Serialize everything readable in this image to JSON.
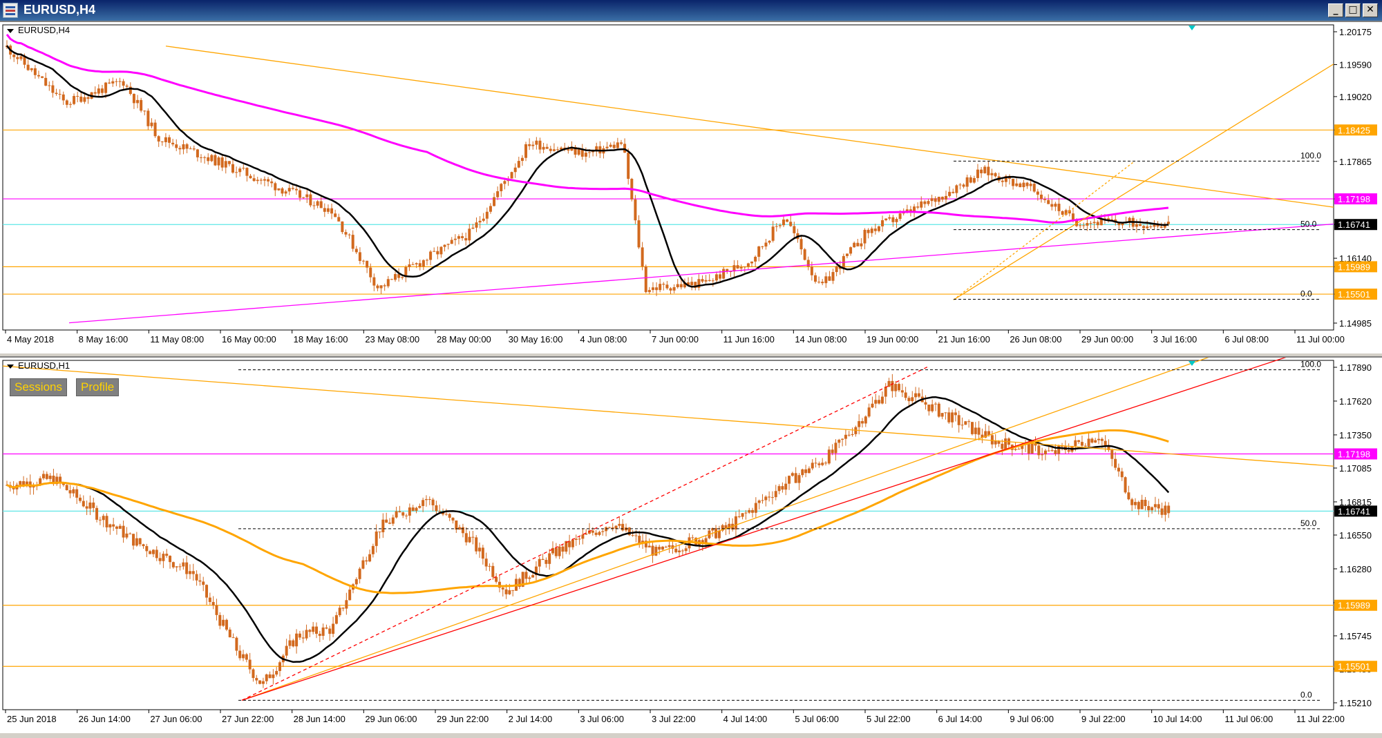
{
  "window": {
    "title": "EURUSD,H4",
    "buttons": [
      "_",
      "□",
      "✕"
    ]
  },
  "colors": {
    "candle": "#d2691e",
    "ma_fast": "#000000",
    "ma_slow_top": "#ff00ff",
    "ma_slow_bottom": "#ffa500",
    "level": "#ffa500",
    "level_magenta": "#ff00ff",
    "level_cyan": "#5ee6e6",
    "trend_red": "#ff0000",
    "fib": "#000000"
  },
  "top_chart": {
    "label": "EURUSD,H4",
    "price_axis": [
      "1.20175",
      "1.19590",
      "1.19020",
      "1.18425",
      "1.17865",
      "1.17198",
      "1.16741",
      "1.16140",
      "1.15989",
      "1.15501",
      "1.14985"
    ],
    "price_range": [
      1.14985,
      1.20175
    ],
    "time_axis": [
      "4 May 2018",
      "8 May 16:00",
      "11 May 08:00",
      "16 May 00:00",
      "18 May 16:00",
      "23 May 08:00",
      "28 May 00:00",
      "30 May 16:00",
      "4 Jun 08:00",
      "7 Jun 00:00",
      "11 Jun 16:00",
      "14 Jun 08:00",
      "19 Jun 00:00",
      "21 Jun 16:00",
      "26 Jun 08:00",
      "29 Jun 00:00",
      "3 Jul 16:00",
      "6 Jul 08:00",
      "11 Jul 00:00"
    ],
    "levels": [
      {
        "price": "1.18425",
        "color": "#ffa500"
      },
      {
        "price": "1.17198",
        "color": "#ff00ff"
      },
      {
        "price": "1.16741",
        "color": "#5ee6e6"
      },
      {
        "price": "1.15989",
        "color": "#ffa500"
      },
      {
        "price": "1.15501",
        "color": "#ffa500"
      }
    ],
    "fib_labels": [
      "100.0",
      "50.0",
      "0.0"
    ],
    "current_price": "1.16741"
  },
  "bottom_chart": {
    "label": "EURUSD,H1",
    "buttons": [
      "Sessions",
      "Profile"
    ],
    "price_axis": [
      "1.17890",
      "1.17620",
      "1.17350",
      "1.17085",
      "1.16815",
      "1.16550",
      "1.16280",
      "1.16010",
      "1.15745",
      "1.15480",
      "1.15210"
    ],
    "price_range": [
      1.1521,
      1.1789
    ],
    "time_axis": [
      "25 Jun 2018",
      "26 Jun 14:00",
      "27 Jun 06:00",
      "27 Jun 22:00",
      "28 Jun 14:00",
      "29 Jun 06:00",
      "29 Jun 22:00",
      "2 Jul 14:00",
      "3 Jul 06:00",
      "3 Jul 22:00",
      "4 Jul 14:00",
      "5 Jul 06:00",
      "5 Jul 22:00",
      "6 Jul 14:00",
      "9 Jul 06:00",
      "9 Jul 22:00",
      "10 Jul 14:00",
      "11 Jul 06:00",
      "11 Jul 22:00"
    ],
    "levels": [
      {
        "price": "1.17198",
        "color": "#ff00ff"
      },
      {
        "price": "1.16741",
        "color": "#5ee6e6"
      },
      {
        "price": "1.15989",
        "color": "#ffa500"
      },
      {
        "price": "1.15501",
        "color": "#ffa500"
      }
    ],
    "fib_labels": [
      "100.0",
      "50.0",
      "0.0"
    ],
    "current_price": "1.16741"
  }
}
